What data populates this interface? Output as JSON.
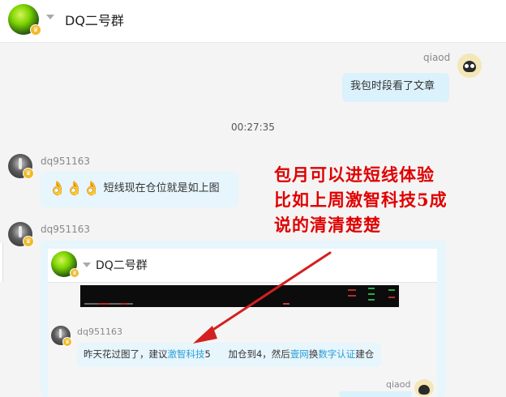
{
  "header": {
    "title": "DQ二号群"
  },
  "messages": {
    "m1": {
      "sender": "qiaod",
      "text": "我包时段看了文章"
    },
    "time1": "00:27:35",
    "m2": {
      "sender": "dq951163",
      "text": "短线现在仓位就是如上图"
    },
    "m3": {
      "sender": "dq951163"
    }
  },
  "forwarded": {
    "title": "DQ二号群",
    "msg": {
      "sender": "dq951163",
      "text_a": "昨天花过图了，建议",
      "link1": "激智科技",
      "text_b": "5",
      "text_c": "加仓到4，然后",
      "link2": "壹网",
      "text_d": "换",
      "link3": "数字认证",
      "text_e": "建仓"
    },
    "reply_sender": "qiaod"
  },
  "annotation": {
    "line1": "包月可以进短线体验",
    "line2": "比如上周激智科技5成",
    "line3": "说的清清楚楚"
  },
  "icons": {
    "badge": "crown-badge-icon",
    "ok": "ok-hand-icon"
  },
  "colors": {
    "annotation": "#e00000",
    "arrow": "#d42020",
    "link": "#2a9fd6",
    "bubble": "#dbf1fb"
  }
}
